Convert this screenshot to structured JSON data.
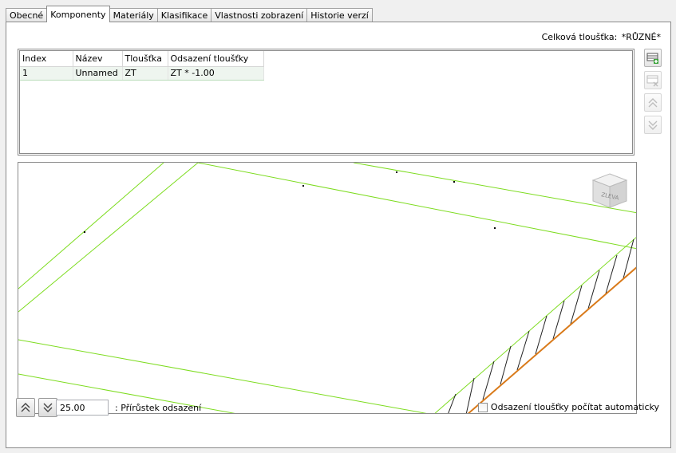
{
  "tabs": [
    "Obecné",
    "Komponenty",
    "Materiály",
    "Klasifikace",
    "Vlastnosti zobrazení",
    "Historie verzí"
  ],
  "active_tab": "Komponenty",
  "total_thickness": {
    "label": "Celková tloušťka:",
    "value": "*RŮZNÉ*"
  },
  "components_table": {
    "columns": [
      "Index",
      "Název",
      "Tloušťka",
      "Odsazení tloušťky"
    ],
    "rows": [
      {
        "index": "1",
        "name": "Unnamed",
        "thickness": "ZT",
        "offset": "ZT * -1.00"
      }
    ]
  },
  "side_buttons": [
    {
      "icon": "add-component-icon",
      "enabled": true
    },
    {
      "icon": "remove-component-icon",
      "enabled": false
    },
    {
      "icon": "move-up-icon",
      "enabled": false
    },
    {
      "icon": "move-down-icon",
      "enabled": false
    }
  ],
  "viewcube": {
    "face_label": "ZLEVA"
  },
  "colors": {
    "outline": "#7ddc1f",
    "edge": "#d97a1a",
    "hatch": "#222222"
  },
  "bottom": {
    "up_icon": "increase-offset-icon",
    "down_icon": "decrease-offset-icon",
    "offset_increment_value": "25.00",
    "offset_increment_label": ": Přírůstek odsazení",
    "auto_offset_label": "Odsazení tloušťky počítat automaticky",
    "auto_offset_checked": false
  }
}
